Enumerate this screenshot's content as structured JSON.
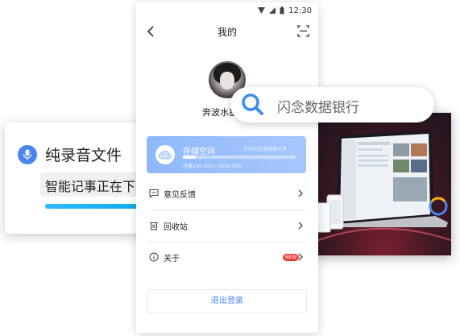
{
  "status_bar": {
    "time": "12:30"
  },
  "header": {
    "title": "我的"
  },
  "profile": {
    "username": "奔波水星"
  },
  "storage": {
    "title": "存储空间",
    "sync_note": "空间与百度网盘共享",
    "capacity_text": "容量236.59G / 2054.00G",
    "used_fraction": 0.115
  },
  "menu": [
    {
      "label": "意见反馈",
      "icon": "feedback-icon"
    },
    {
      "label": "回收站",
      "icon": "trash-icon"
    },
    {
      "label": "关于",
      "icon": "info-icon",
      "badge": "NEW"
    }
  ],
  "logout_label": "退出登录",
  "search": {
    "text": "闪念数据银行"
  },
  "voice_card": {
    "title": "纯录音文件",
    "subtitle": "智能记事正在下",
    "progress_fraction": 0.85
  },
  "colors": {
    "accent": "#4a86f0",
    "storage_card": "#9dc1fb",
    "badge": "#f0403a"
  }
}
